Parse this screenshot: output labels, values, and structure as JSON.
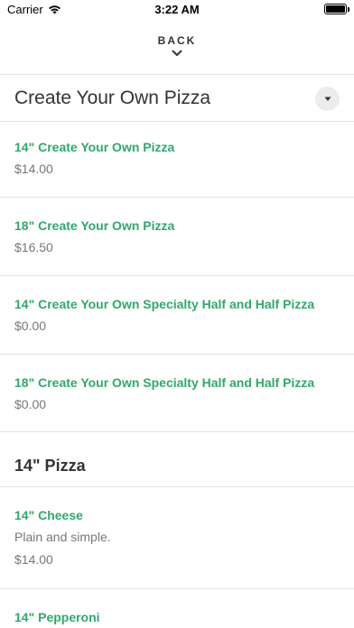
{
  "status_bar": {
    "carrier": "Carrier",
    "time": "3:22 AM"
  },
  "nav": {
    "back_label": "BACK"
  },
  "sections": [
    {
      "title": "Create Your Own Pizza",
      "items": [
        {
          "name": "14\" Create Your Own Pizza",
          "price": "$14.00"
        },
        {
          "name": "18\" Create Your Own Pizza",
          "price": "$16.50"
        },
        {
          "name": "14\" Create Your Own Specialty Half and Half Pizza",
          "price": "$0.00"
        },
        {
          "name": "18\" Create Your Own Specialty Half and Half Pizza",
          "price": "$0.00"
        }
      ]
    },
    {
      "title": "14\" Pizza",
      "items": [
        {
          "name": "14\" Cheese",
          "description": "Plain and simple.",
          "price": "$14.00"
        },
        {
          "name": "14\" Pepperoni"
        }
      ]
    }
  ],
  "colors": {
    "accent": "#2eaa6a",
    "text": "#333333",
    "muted": "#777777",
    "divider": "#e3e3e3"
  }
}
